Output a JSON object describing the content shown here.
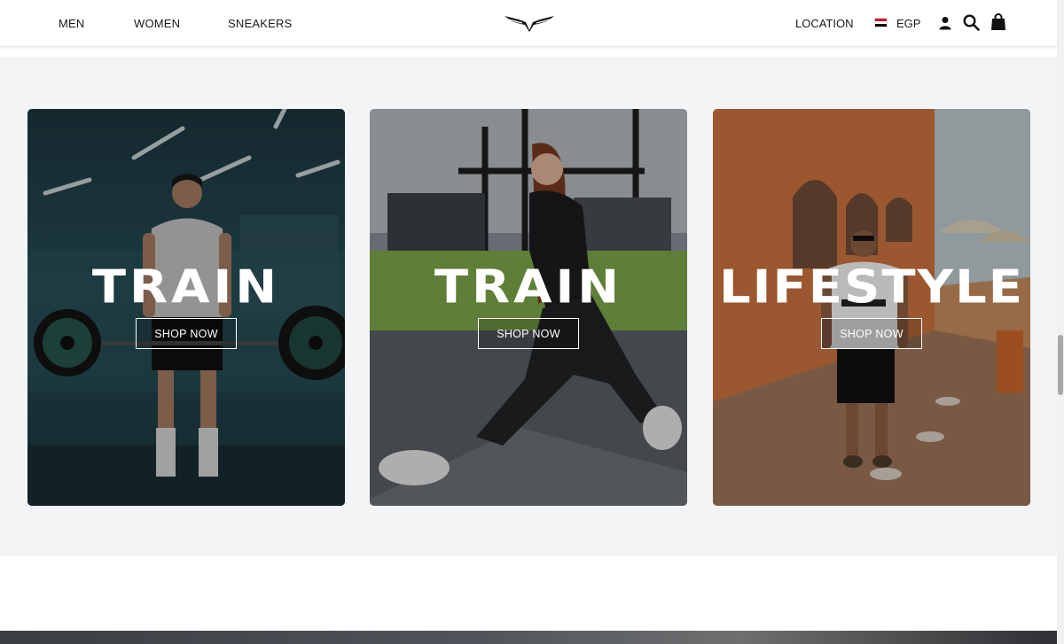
{
  "nav": {
    "left_links": [
      "MEN",
      "WOMEN",
      "SNEAKERS"
    ],
    "location_label": "LOCATION",
    "currency": "EGP",
    "icons": [
      "eagle-logo",
      "user-icon",
      "search-icon",
      "shopping-bag-icon",
      "egypt-flag-icon"
    ]
  },
  "cards": [
    {
      "title": "TRAIN",
      "button": "SHOP NOW",
      "scene": "gym-man-deadlift"
    },
    {
      "title": "TRAIN",
      "button": "SHOP NOW",
      "scene": "gym-woman-kneeling"
    },
    {
      "title": "LIFESTYLE",
      "button": "SHOP NOW",
      "scene": "street-man-standing"
    }
  ],
  "colors": {
    "section_bg": "#f2f4f6",
    "header_bg": "#ffffff",
    "text": "#1a1a1a",
    "flag_red": "#ce1126",
    "flag_black": "#000000"
  }
}
